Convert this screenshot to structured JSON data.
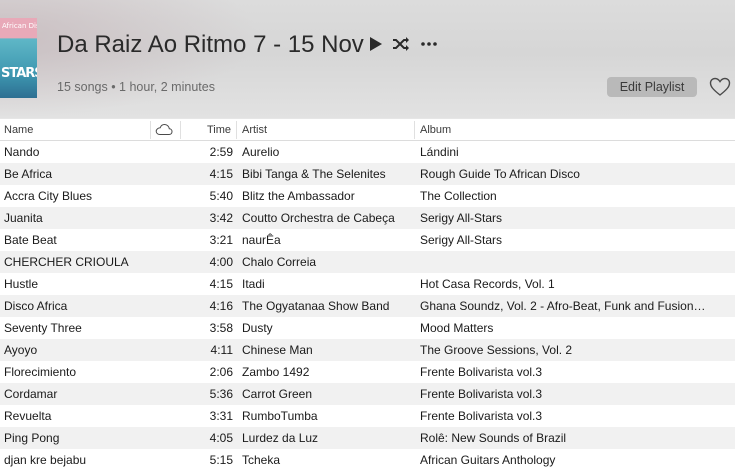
{
  "playlist": {
    "art_text": "African Disco",
    "art_big": "STARS",
    "title": "Da Raiz Ao Ritmo 7 - 15 Nov",
    "subtitle": "15 songs • 1 hour, 2 minutes",
    "edit_label": "Edit Playlist"
  },
  "columns": {
    "name": "Name",
    "time": "Time",
    "artist": "Artist",
    "album": "Album"
  },
  "songs": [
    {
      "name": "Nando",
      "time": "2:59",
      "artist": "Aurelio",
      "album": "Lándini"
    },
    {
      "name": "Be Africa",
      "time": "4:15",
      "artist": "Bibi Tanga & The Selenites",
      "album": "Rough Guide To African Disco"
    },
    {
      "name": "Accra City Blues",
      "time": "5:40",
      "artist": "Blitz the Ambassador",
      "album": "The Collection"
    },
    {
      "name": "Juanita",
      "time": "3:42",
      "artist": "Coutto Orchestra de Cabeça",
      "album": "Serigy All-Stars"
    },
    {
      "name": "Bate Beat",
      "time": "3:21",
      "artist": "naurÊa",
      "album": "Serigy All-Stars"
    },
    {
      "name": "CHERCHER CRIOULA",
      "time": "4:00",
      "artist": "Chalo Correia",
      "album": ""
    },
    {
      "name": "Hustle",
      "time": "4:15",
      "artist": "Itadi",
      "album": "Hot Casa Records, Vol. 1"
    },
    {
      "name": "Disco Africa",
      "time": "4:16",
      "artist": "The Ogyatanaa Show Band",
      "album": "Ghana Soundz, Vol. 2 - Afro-Beat, Funk and Fusion…"
    },
    {
      "name": "Seventy Three",
      "time": "3:58",
      "artist": "Dusty",
      "album": "Mood Matters"
    },
    {
      "name": "Ayoyo",
      "time": "4:11",
      "artist": "Chinese Man",
      "album": "The Groove Sessions, Vol. 2"
    },
    {
      "name": "Florecimiento",
      "time": "2:06",
      "artist": "Zambo 1492",
      "album": "Frente Bolivarista vol.3"
    },
    {
      "name": "Cordamar",
      "time": "5:36",
      "artist": "Carrot Green",
      "album": "Frente Bolivarista vol.3"
    },
    {
      "name": "Revuelta",
      "time": "3:31",
      "artist": "RumboTumba",
      "album": "Frente Bolivarista vol.3"
    },
    {
      "name": "Ping Pong",
      "time": "4:05",
      "artist": "Lurdez da Luz",
      "album": "Rolê: New Sounds of Brazil"
    },
    {
      "name": "djan kre bejabu",
      "time": "5:15",
      "artist": "Tcheka",
      "album": "African Guitars Anthology"
    }
  ]
}
